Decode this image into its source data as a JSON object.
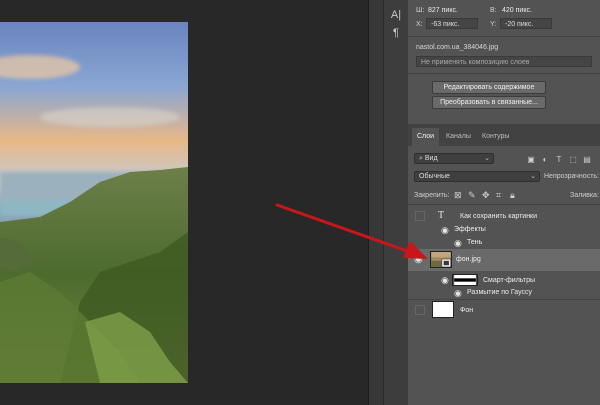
{
  "properties": {
    "w_label": "Ш:",
    "w_value": "827 пикс.",
    "h_label": "В:",
    "h_value": "420 пикс.",
    "x_label": "X:",
    "x_value": "-63 пикс.",
    "y_label": "Y:",
    "y_value": "-20 пикс.",
    "filename": "nastol.com.ua_384046.jpg",
    "comps_placeholder": "Не применять композицию слоев",
    "edit_contents_btn": "Редактировать содержимое",
    "convert_linked_btn": "Преобразовать в связанные..."
  },
  "tools": {
    "text_tool": "A|",
    "para_tool": "¶"
  },
  "layers_panel": {
    "tabs": [
      "Слои",
      "Каналы",
      "Контуры"
    ],
    "filter_kind": "Вид",
    "blend_mode": "Обычные",
    "opacity_label": "Непрозрачность:",
    "lock_label": "Закрепить:",
    "fill_label": "Заливка:",
    "layers": [
      {
        "name": "Как сохранить картинки",
        "type": "text"
      },
      {
        "name": "Эффекты",
        "type": "effects-group"
      },
      {
        "name": "Тень",
        "type": "effect"
      },
      {
        "name": "фон.jpg",
        "type": "smart-object"
      },
      {
        "name": "Смарт-фильтры",
        "type": "smart-filters"
      },
      {
        "name": "Размытие по Гауссу",
        "type": "filter"
      },
      {
        "name": "Фон",
        "type": "background"
      }
    ]
  },
  "colors": {
    "arrow": "#c8161b",
    "panel_bg": "#535353",
    "selected_row": "#6a6a6a"
  }
}
